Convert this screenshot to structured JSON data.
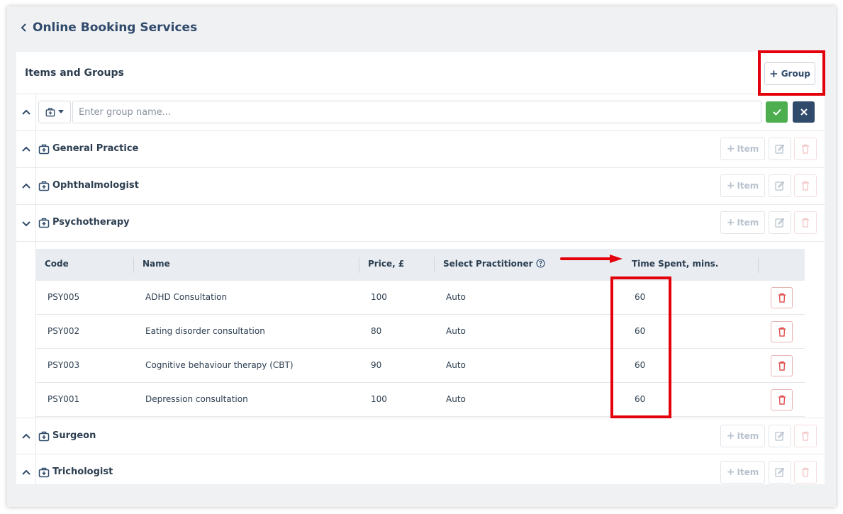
{
  "page": {
    "title": "Online Booking Services"
  },
  "card": {
    "title": "Items and Groups",
    "add_group_label": "Group"
  },
  "new_group": {
    "placeholder": "Enter group name..."
  },
  "action_labels": {
    "item": "Item"
  },
  "groups": [
    {
      "name": "General Practice",
      "expanded": false
    },
    {
      "name": "Ophthalmologist",
      "expanded": false
    },
    {
      "name": "Psychotherapy",
      "expanded": true
    },
    {
      "name": "Surgeon",
      "expanded": false
    },
    {
      "name": "Trichologist",
      "expanded": false
    }
  ],
  "table": {
    "headers": {
      "code": "Code",
      "name": "Name",
      "price": "Price, £",
      "practitioner": "Select Practitioner",
      "time": "Time Spent, mins."
    },
    "rows": [
      {
        "code": "PSY005",
        "name": "ADHD Consultation",
        "price": "100",
        "practitioner": "Auto",
        "time": "60"
      },
      {
        "code": "PSY002",
        "name": "Eating disorder consultation",
        "price": "80",
        "practitioner": "Auto",
        "time": "60"
      },
      {
        "code": "PSY003",
        "name": "Cognitive behaviour therapy (CBT)",
        "price": "90",
        "practitioner": "Auto",
        "time": "60"
      },
      {
        "code": "PSY001",
        "name": "Depression consultation",
        "price": "100",
        "practitioner": "Auto",
        "time": "60"
      }
    ]
  },
  "colors": {
    "accent": "#2f4a6b",
    "confirm": "#4cae4f",
    "annotation": "#e3000b",
    "delete": "#e05252"
  }
}
